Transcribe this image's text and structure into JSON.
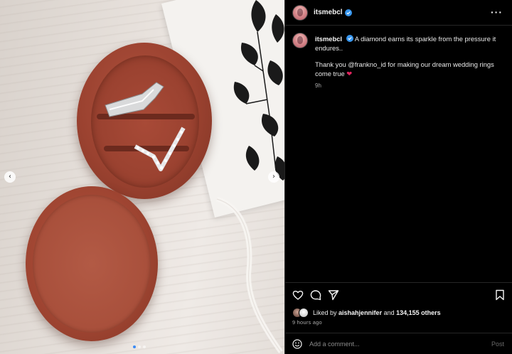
{
  "post": {
    "username": "itsmebcl",
    "verified": true,
    "caption_line1": "A diamond earns its sparkle from the pressure it endures..",
    "caption_line2": "Thank you @frankno_id for making our dream wedding rings come true",
    "caption_emoji": "❤",
    "caption_time": "9h",
    "likes_prefix": "Liked by",
    "liked_by_user": "aishahjennifer",
    "likes_and": "and",
    "likes_others": "134,155 others",
    "posted_ago": "9 hours ago"
  },
  "header": {
    "more_label": "···"
  },
  "carousel": {
    "prev_label": "‹",
    "next_label": "›",
    "slide_count": 3,
    "active_slide": 1
  },
  "comment": {
    "placeholder": "Add a comment...",
    "post_label": "Post"
  },
  "icons": [
    "heart-icon",
    "comment-icon",
    "share-icon",
    "bookmark-icon",
    "emoji-icon",
    "verified-badge-icon",
    "more-options-icon"
  ],
  "colors": {
    "background": "#000000",
    "verified_blue": "#3897f0",
    "heart_red": "#e0245e",
    "velvet": "#9b4230"
  }
}
